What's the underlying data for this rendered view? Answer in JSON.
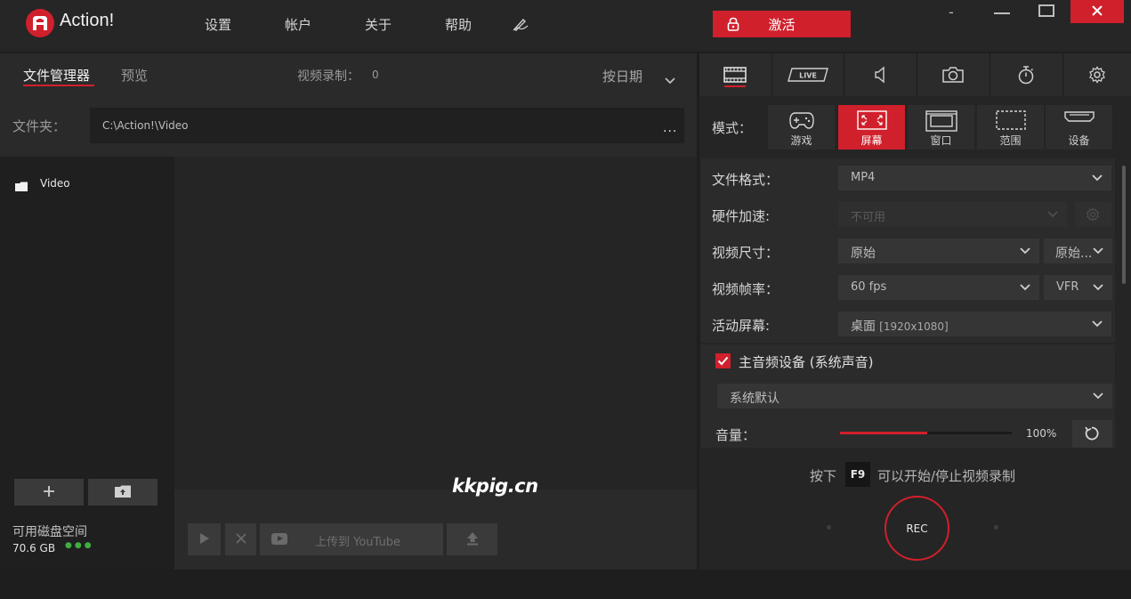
{
  "app": {
    "name": "Action!"
  },
  "nav": {
    "settings": "设置",
    "account": "帐户",
    "about": "关于",
    "help": "帮助"
  },
  "activate_label": "激活",
  "window": {
    "minimize_glyph": "-"
  },
  "left": {
    "tabs": {
      "files": "文件管理器",
      "preview": "预览"
    },
    "recording_count_label": "视频录制：",
    "recording_count_value": "0",
    "sort_label": "按日期",
    "folder_label": "文件夹：",
    "folder_path": "C:\\Action!\\Video",
    "browse_label": "...",
    "tree": [
      {
        "label": "Video"
      }
    ],
    "disk_label": "可用磁盘空间",
    "disk_value": "70.6 GB",
    "disk_dots": "●●●",
    "youtube_label": "上传到 YouTube"
  },
  "watermark": "kkpig.cn",
  "right": {
    "mode_label": "模式：",
    "modes": [
      {
        "label": "游戏",
        "icon": "gamepad-icon"
      },
      {
        "label": "屏幕",
        "icon": "screen-icon"
      },
      {
        "label": "窗口",
        "icon": "window-icon"
      },
      {
        "label": "范围",
        "icon": "region-icon"
      },
      {
        "label": "设备",
        "icon": "device-icon"
      }
    ],
    "active_mode": 1,
    "settings": {
      "file_format_label": "文件格式：",
      "file_format_value": "MP4",
      "hw_accel_label": "硬件加速:",
      "hw_accel_value": "不可用",
      "video_size_label": "视频尺寸：",
      "video_size_value": "原始",
      "video_size_value2": "原始...",
      "frame_rate_label": "视频帧率：",
      "frame_rate_value": "60 fps",
      "frame_rate_mode": "VFR",
      "active_screen_label": "活动屏幕:",
      "active_screen_value": "桌面",
      "active_screen_res": "[1920x1080]"
    },
    "audio": {
      "main_label": "主音频设备 (系统声音)",
      "checked": true,
      "device_value": "系统默认",
      "volume_label": "音量：",
      "volume_value": "100%",
      "volume_fraction": 0.51
    },
    "hotkey": {
      "pre": "按下",
      "key": "F9",
      "post": "可以开始/停止视频录制"
    },
    "rec_label": "REC"
  },
  "colors": {
    "accent": "#d0202c",
    "disk_ok": "#3fae3f"
  }
}
